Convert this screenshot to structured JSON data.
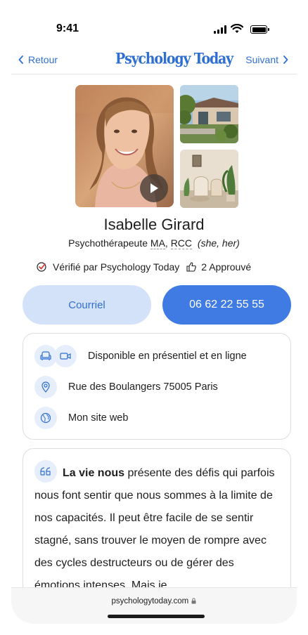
{
  "status": {
    "time": "9:41"
  },
  "nav": {
    "back_label": "Retour",
    "logo": "Psychology Today",
    "next_label": "Suivant"
  },
  "profile": {
    "name": "Isabelle Girard",
    "title": "Psychothérapeute",
    "cred1": "MA",
    "cred_sep": ",",
    "cred2": "RCC",
    "pronouns": "(she, her)",
    "verified_label": "Vérifié par Psychology Today",
    "endorsements": "2 Approuvé"
  },
  "actions": {
    "email_label": "Courriel",
    "phone_label": "06 62 22 55 55"
  },
  "info": {
    "availability": "Disponible en présentiel et en ligne",
    "address": "Rue des Boulangers 75005 Paris",
    "website": "Mon site web"
  },
  "about": {
    "lead": "La vie nous",
    "text": " présente des défis qui parfois nous font sentir que nous sommes à la limite de nos capacités. Il peut être facile de se sentir stagné, sans trouver le moyen de rompre avec des cycles destructeurs ou de gérer des émotions intenses. Mais je"
  },
  "browser": {
    "url": "psychologytoday.com"
  },
  "colors": {
    "accent": "#2f6fd1",
    "button_primary": "#3f7be3",
    "button_secondary": "#d4e2f9",
    "icon_bg": "#e6eefb"
  }
}
